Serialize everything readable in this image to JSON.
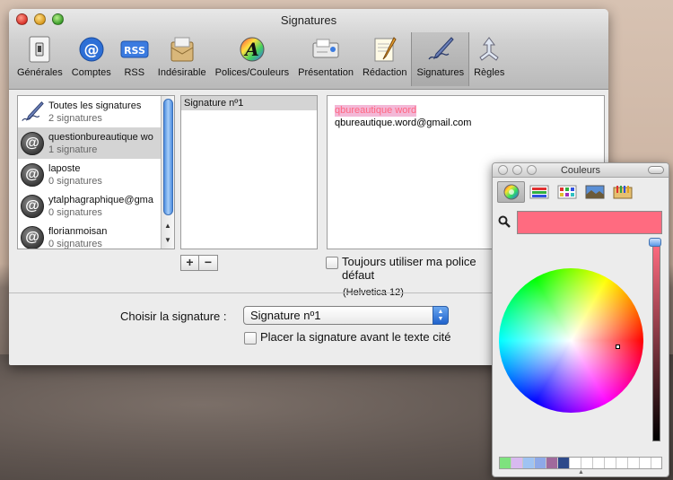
{
  "window": {
    "title": "Signatures"
  },
  "toolbar": [
    {
      "label": "Générales",
      "icon": "switch-icon"
    },
    {
      "label": "Comptes",
      "icon": "at-icon"
    },
    {
      "label": "RSS",
      "icon": "rss-icon"
    },
    {
      "label": "Indésirable",
      "icon": "junk-icon"
    },
    {
      "label": "Polices/Couleurs",
      "icon": "fonts-icon"
    },
    {
      "label": "Présentation",
      "icon": "viewing-icon"
    },
    {
      "label": "Rédaction",
      "icon": "composing-icon"
    },
    {
      "label": "Signatures",
      "icon": "signature-pen-icon",
      "selected": true
    },
    {
      "label": "Règles",
      "icon": "rules-icon"
    }
  ],
  "accounts": [
    {
      "name": "Toutes les signatures",
      "count": "2 signatures"
    },
    {
      "name": "questionbureautique wo",
      "count": "1 signature"
    },
    {
      "name": "laposte",
      "count": "0 signatures"
    },
    {
      "name": "ytalphagraphique@gma",
      "count": "0 signatures"
    },
    {
      "name": "florianmoisan",
      "count": "0 signatures"
    }
  ],
  "signatures": [
    "Signature nº1"
  ],
  "editor": {
    "line1": "qbureautique word",
    "line2": "qbureautique.word@gmail.com"
  },
  "font_option": {
    "label": "Toujours utiliser ma police défaut",
    "font": "(Helvetica 12)",
    "checked": false
  },
  "choose": {
    "label": "Choisir la signature :",
    "value": "Signature nº1"
  },
  "place_option": {
    "label": "Placer la signature avant le texte cité",
    "checked": false
  },
  "buttons": {
    "add": "+",
    "remove": "−"
  },
  "colors_panel": {
    "title": "Couleurs",
    "current_color": "#ff6b80",
    "palette": [
      "#7ee27e",
      "#d8b9f0",
      "#9fc3f2",
      "#8ea9e8",
      "#a06a9c",
      "#2e4a8a"
    ]
  }
}
